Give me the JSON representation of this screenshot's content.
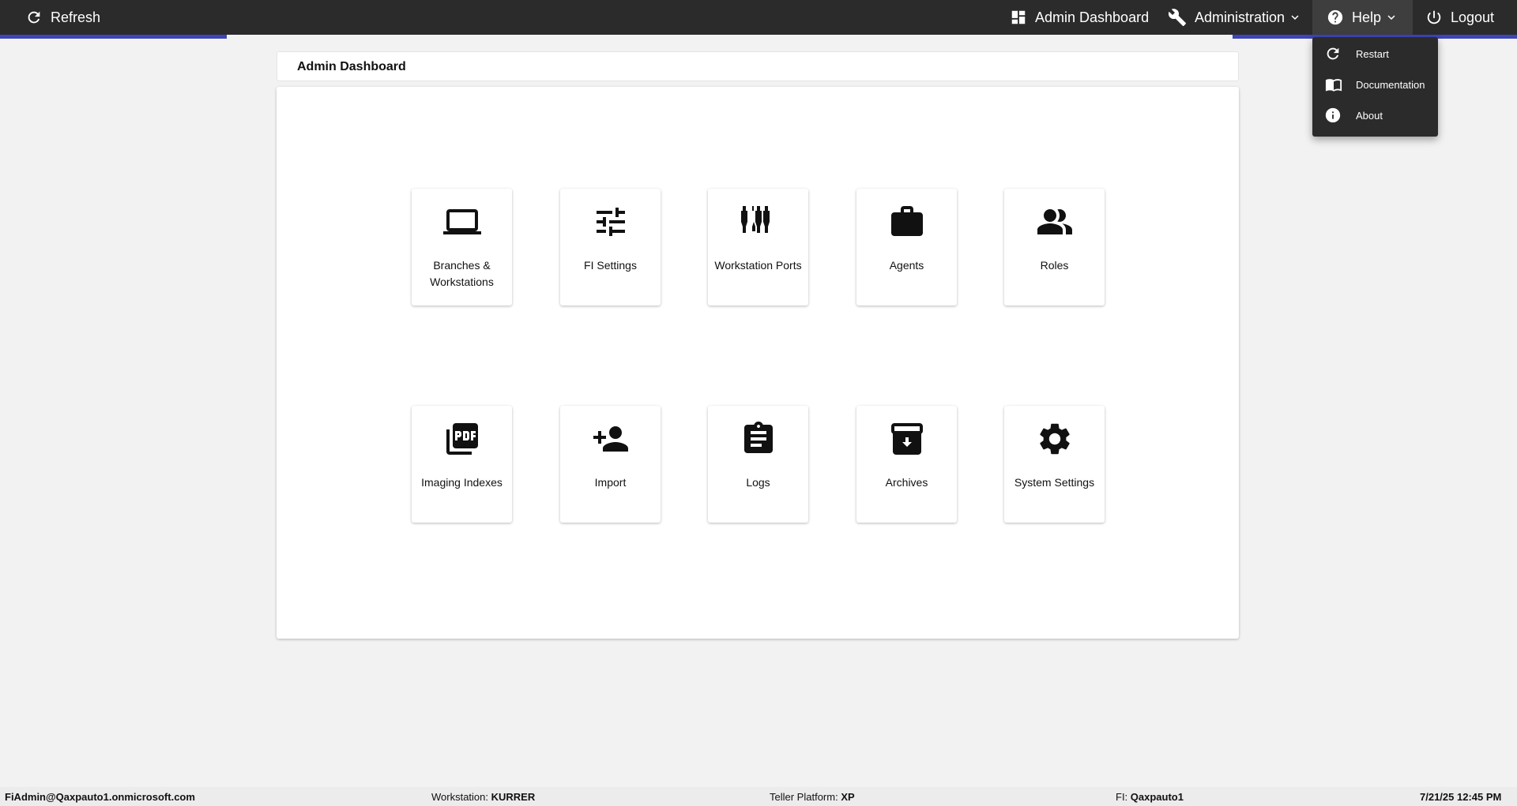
{
  "topbar": {
    "refresh_label": "Refresh",
    "admin_dashboard_label": "Admin Dashboard",
    "administration_label": "Administration",
    "help_label": "Help",
    "logout_label": "Logout"
  },
  "help_menu": {
    "items": [
      {
        "label": "Restart",
        "icon": "restart-icon"
      },
      {
        "label": "Documentation",
        "icon": "book-icon"
      },
      {
        "label": "About",
        "icon": "info-icon"
      }
    ]
  },
  "page": {
    "title": "Admin Dashboard"
  },
  "tiles": [
    {
      "label": "Branches & Workstations",
      "icon": "laptop-icon"
    },
    {
      "label": "FI Settings",
      "icon": "sliders-icon"
    },
    {
      "label": "Workstation Ports",
      "icon": "ports-icon"
    },
    {
      "label": "Agents",
      "icon": "briefcase-icon"
    },
    {
      "label": "Roles",
      "icon": "people-icon"
    },
    {
      "label": "Imaging Indexes",
      "icon": "pdf-icon"
    },
    {
      "label": "Import",
      "icon": "person-add-icon"
    },
    {
      "label": "Logs",
      "icon": "clipboard-icon"
    },
    {
      "label": "Archives",
      "icon": "archive-icon"
    },
    {
      "label": "System Settings",
      "icon": "gear-icon"
    }
  ],
  "statusbar": {
    "user": "FiAdmin@Qaxpauto1.onmicrosoft.com",
    "workstation_label": "Workstation: ",
    "workstation_value": "KURRER",
    "platform_label": "Teller Platform: ",
    "platform_value": "XP",
    "fi_label": "FI: ",
    "fi_value": "Qaxpauto1",
    "datetime": "7/21/25 12:45 PM"
  },
  "colors": {
    "topbar": "#2b2b2b",
    "accent": "#3d45b8",
    "background": "#f2f2f2"
  }
}
